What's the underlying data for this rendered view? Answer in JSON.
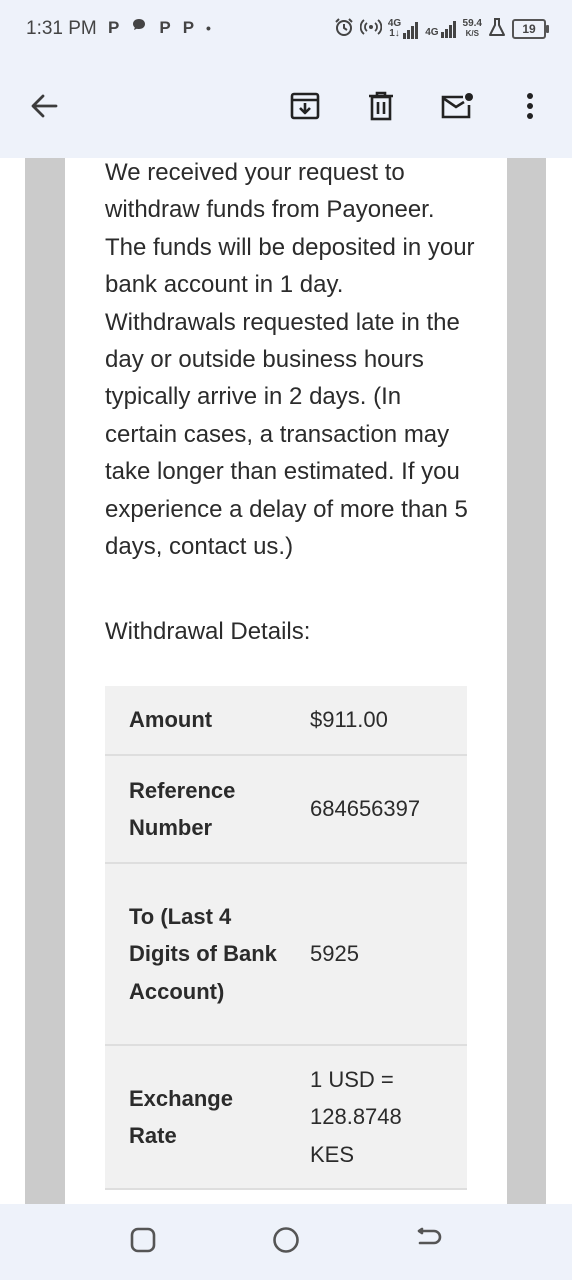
{
  "status_bar": {
    "time": "1:31 PM",
    "notifications": [
      "P",
      "P",
      "P",
      "P",
      "•"
    ],
    "net1_top": "4G",
    "net1_bottom": "1↓",
    "net2_top": "4G",
    "speed_top": "59.4",
    "speed_bottom": "K/S",
    "battery": "19",
    "icons": [
      "alarm-icon",
      "hotspot-icon",
      "signal-icon",
      "signal-icon",
      "lab-flask-icon",
      "battery-icon"
    ]
  },
  "toolbar": {
    "icons": [
      "back-arrow-icon",
      "archive-icon",
      "delete-icon",
      "mark-unread-icon",
      "more-vert-icon"
    ]
  },
  "email": {
    "body": "We received your request to withdraw funds from Payoneer. The funds will be deposited in your bank account in 1 day. Withdrawals requested late in the day or outside business hours typically arrive in 2 days. (In certain cases, a transaction may take longer than estimated. If you experience a delay of more than 5 days, contact us.)",
    "details_label": "Withdrawal Details:",
    "details": [
      {
        "label": "Amount",
        "value": "$911.00"
      },
      {
        "label": "Reference Number",
        "value": "684656397"
      },
      {
        "label": "To (Last 4 Digits of Bank Account)",
        "value": "5925"
      },
      {
        "label": "Exchange Rate",
        "value": "1 USD = 128.8748 KES"
      }
    ]
  },
  "nav_bar": {
    "icons": [
      "recents-icon",
      "home-icon",
      "back-icon"
    ]
  },
  "colors": {
    "app_bg": "#eef2fa",
    "gutter": "#cbcbcb",
    "table_bg": "#f1f1f1",
    "text": "#2b2b2b"
  }
}
